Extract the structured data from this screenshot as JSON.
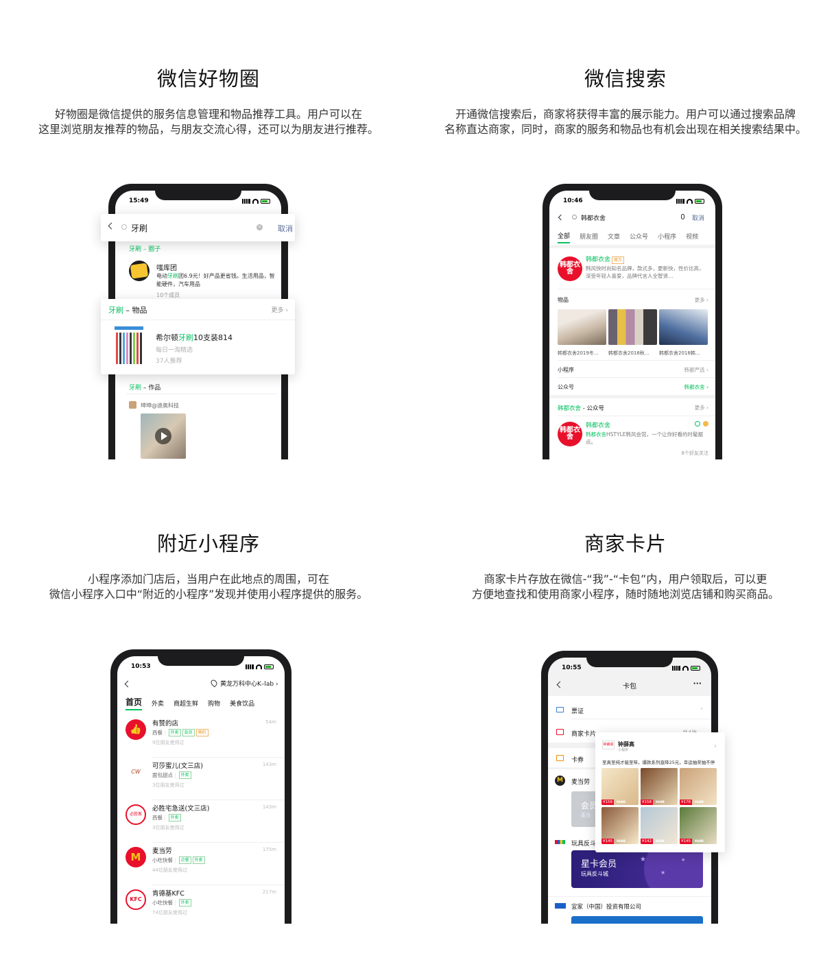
{
  "features": [
    {
      "title": "微信好物圈",
      "desc_line1": "好物圈是微信提供的服务信息管理和物品推荐工具。用户可以在",
      "desc_line2": "这里浏览朋友推荐的物品，与朋友交流心得，还可以为朋友进行推荐。"
    },
    {
      "title": "微信搜索",
      "desc_line1": "开通微信搜索后，商家将获得丰富的展示能力。用户可以通过搜索品牌",
      "desc_line2": "名称直达商家，同时，商家的服务和物品也有机会出现在相关搜索结果中。"
    },
    {
      "title": "附近小程序",
      "desc_line1": "小程序添加门店后，当用户在此地点的周围，可在",
      "desc_line2": "微信小程序入口中“附近的小程序”发现并使用小程序提供的服务。"
    },
    {
      "title": "商家卡片",
      "desc_line1": "商家卡片存放在微信-“我”-“卡包”内，用户领取后，可以更",
      "desc_line2": "方便地查找和使用商家小程序，随时随地浏览店铺和购买商品。"
    }
  ],
  "phone1": {
    "time": "15:49",
    "search_value": "牙刷",
    "cancel": "取消",
    "group_header_cut": "牙刷 – 圈子",
    "group_name": "嗤库团",
    "group_desc_pre": "电动",
    "group_desc_hl": "牙刷",
    "group_desc_post": "团6.9元！好产品更省钱。生活用品，智能硬件，汽车用品",
    "group_members": "10个成员",
    "items_header_kw": "牙刷",
    "items_header_rest": " – 物品",
    "more": "更多",
    "item_title_pre": "希尔顿",
    "item_title_hl": "牙刷",
    "item_title_post": "10支装814",
    "item_source": "每日一淘精选",
    "item_recommend": "37人推荐",
    "works_kw": "牙刷",
    "works_rest": " – 作品",
    "author": "坤坤@迪奥科技"
  },
  "phone2": {
    "time": "10:46",
    "search_value": "韩都衣舍",
    "cancel": "取消",
    "tabs": [
      "全部",
      "朋友圈",
      "文章",
      "公众号",
      "小程序",
      "视频"
    ],
    "logo_text": "韩都衣舍",
    "brand_name": "韩都衣舍",
    "official_badge": "官方",
    "brand_desc": "韩风快时尚知名品牌，款式多，更新快，性价比高，深受年轻人喜爱，品牌代言人全智贤…",
    "goods_label": "物品",
    "more": "更多",
    "goods": [
      "韩都衣舍2019冬…",
      "韩都衣舍2018秋…",
      "韩都衣舍2018韩…"
    ],
    "miniapp_label": "小程序",
    "miniapp_value": "韩都严选",
    "account_label": "公众号",
    "account_value": "韩都衣舍",
    "section2_kw": "韩都衣舍",
    "section2_rest": " - 公众号",
    "acc_name": "韩都衣舍",
    "acc_desc_hl": "韩都衣舍",
    "acc_desc": "HSTYLE韩风会馆，一个让你好看的时髦据点。",
    "acc_friends": "8个好友关注"
  },
  "phone3": {
    "time": "10:53",
    "location": "黄龙万科中心K–lab",
    "tabs": [
      "首页",
      "外卖",
      "商超生鲜",
      "购物",
      "美食饮品"
    ],
    "stores": [
      {
        "name": "有赞的店",
        "category": "西餐",
        "tags": [
          "外卖",
          "会员",
          "预约"
        ],
        "users": "9位朋友使用过",
        "distance": "54m",
        "logo": "👍"
      },
      {
        "name": "可莎蜜儿(文三店)",
        "category": "面包甜点",
        "tags": [
          "外卖"
        ],
        "users": "3位朋友使用过",
        "distance": "143m",
        "logo": "CW"
      },
      {
        "name": "必胜宅急送(文三店)",
        "category": "西餐",
        "tags": [
          "外卖"
        ],
        "users": "3位朋友使用过",
        "distance": "143m",
        "logo": "必胜客"
      },
      {
        "name": "麦当劳",
        "category": "小吃快餐",
        "tags": [
          "点餐",
          "外卖"
        ],
        "users": "44位朋友使用过",
        "distance": "175m",
        "logo": "M"
      },
      {
        "name": "肯德基KFC",
        "category": "小吃快餐",
        "tags": [
          "外卖"
        ],
        "users": "74位朋友使用过",
        "distance": "217m",
        "logo": "KFC"
      }
    ]
  },
  "phone4": {
    "time": "10:55",
    "title": "卡包",
    "menu": "···",
    "rows": [
      {
        "label": "票证",
        "value": ""
      },
      {
        "label": "商家卡片",
        "value": "共4张"
      },
      {
        "label": "卡券",
        "value": ""
      }
    ],
    "mcd": "麦当劳",
    "mcd_card_text": "会员",
    "mcd_card_sub": "麦当",
    "toy_label": "玩具反斗",
    "star_card_title": "星卡会员",
    "star_card_sub": "玩具反斗城",
    "ikea": "宜家（中国）投资有限公司",
    "popup_name": "钟薛高",
    "popup_sub": "小程序",
    "popup_desc": "至真至纯才能至味，爆款系列直降25元，幸运抽奖抽不停",
    "products": [
      {
        "price": "¥158",
        "old": "¥168"
      },
      {
        "price": "¥158",
        "old": "¥168"
      },
      {
        "price": "¥178",
        "old": "¥188"
      },
      {
        "price": "¥145",
        "old": "¥168"
      },
      {
        "price": "¥142",
        "old": "¥168"
      },
      {
        "price": "¥145",
        "old": "¥168"
      }
    ]
  },
  "colors": {
    "wechat_green": "#07c160",
    "brand_red": "#e8102b",
    "link_blue": "#576b95"
  }
}
